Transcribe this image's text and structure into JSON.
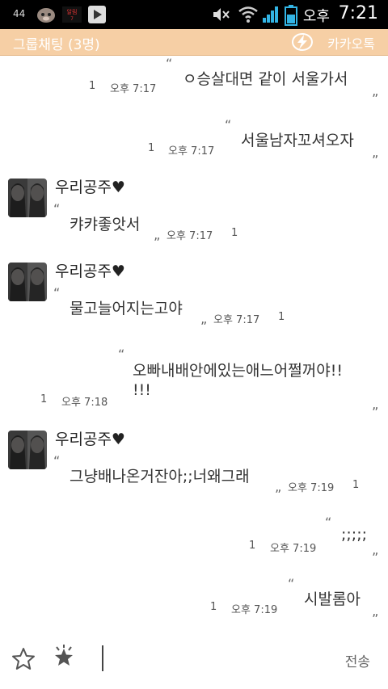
{
  "status_bar": {
    "notif_count": "44",
    "ampm": "오후",
    "time": "7:21",
    "icons": [
      "animal-face-icon",
      "notification-badge-icon",
      "play-store-icon",
      "mute-icon",
      "wifi-icon",
      "signal-icon",
      "battery-icon"
    ]
  },
  "header": {
    "title": "그룹채팅 (3명)",
    "brand": "카카오톡",
    "brand_icon": "kakaotalk-logo-icon"
  },
  "messages": [
    {
      "text": "ㅇ승살대면 같이 서울가서",
      "unread": "1",
      "time": "오후 7:17",
      "side": "right"
    },
    {
      "text": "서울남자꼬셔오자",
      "unread": "1",
      "time": "오후 7:17",
      "side": "right"
    },
    {
      "sender": "우리공주♥",
      "text": "캬캬좋앗서",
      "unread": "1",
      "time": "오후 7:17",
      "side": "left"
    },
    {
      "sender": "우리공주♥",
      "text": "물고늘어지는고야",
      "unread": "1",
      "time": "오후 7:17",
      "side": "left"
    },
    {
      "text": "오빠내배안에있는애느어쩔꺼야!!",
      "text2": "!!!",
      "unread": "1",
      "time": "오후 7:18",
      "side": "right"
    },
    {
      "sender": "우리공주♥",
      "text": "그냥배나온거잔아;;너왜그래",
      "unread": "1",
      "time": "오후 7:19",
      "side": "left"
    },
    {
      "text": ";;;;;",
      "unread": "1",
      "time": "오후 7:19",
      "side": "right"
    },
    {
      "text": "시발롬아",
      "unread": "1",
      "time": "오후 7:19",
      "side": "right"
    }
  ],
  "bottom": {
    "send_label": "전송",
    "icons": [
      "star-outline-icon",
      "emoticon-star-icon"
    ]
  }
}
